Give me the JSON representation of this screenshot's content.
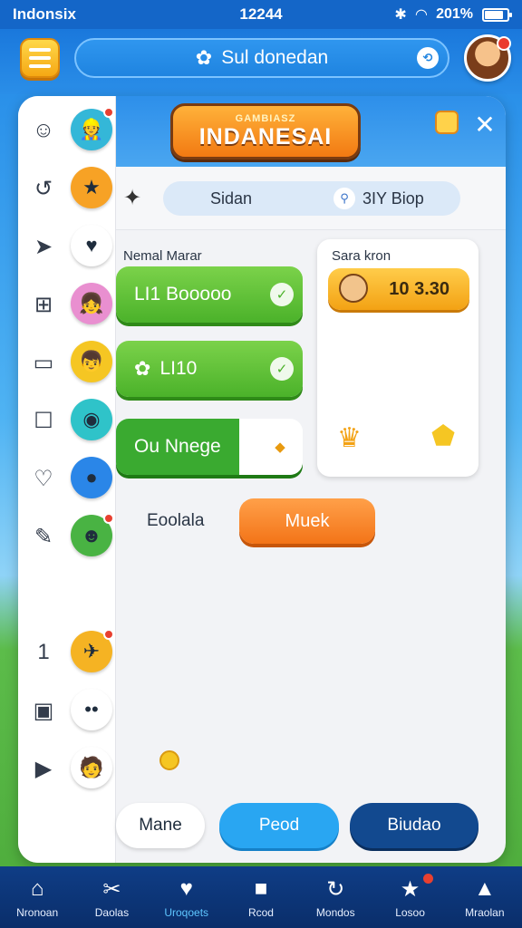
{
  "status_bar": {
    "app_name": "Indonsix",
    "time": "12244",
    "battery": "201%"
  },
  "topbar": {
    "search_text": "Sul donedan"
  },
  "rail": [
    {
      "glyph": "☺",
      "icon": "smiley-icon",
      "avatar": "👷",
      "avatar_bg": "#34b7d8",
      "dot": true
    },
    {
      "glyph": "↺",
      "icon": "refresh-icon",
      "avatar": "★",
      "avatar_bg": "#f7a225",
      "dot": false
    },
    {
      "glyph": "➤",
      "icon": "send-icon",
      "avatar": "♥",
      "avatar_bg": "#ffffff",
      "dot": false
    },
    {
      "glyph": "⊞",
      "icon": "grid-icon",
      "avatar": "👧",
      "avatar_bg": "#e98fd0",
      "dot": false
    },
    {
      "glyph": "▭",
      "icon": "clipboard-icon",
      "avatar": "👦",
      "avatar_bg": "#f5c623",
      "dot": false
    },
    {
      "glyph": "☐",
      "icon": "square-icon",
      "avatar": "◉",
      "avatar_bg": "#2fc3c9",
      "dot": false
    },
    {
      "glyph": "♡",
      "icon": "heart-icon",
      "avatar": "●",
      "avatar_bg": "#2a86e8",
      "dot": false
    },
    {
      "glyph": "✎",
      "icon": "edit-icon",
      "avatar": "☻",
      "avatar_bg": "#49b343",
      "dot": true
    },
    {
      "glyph": "",
      "icon": "blank-icon",
      "avatar": "",
      "avatar_bg": "#f2f3f6",
      "dot": false
    },
    {
      "glyph": "1",
      "icon": "number-icon",
      "avatar": "✈",
      "avatar_bg": "#f5b323",
      "dot": true
    },
    {
      "glyph": "▣",
      "icon": "image-icon",
      "avatar": "••",
      "avatar_bg": "#ffffff",
      "dot": false
    },
    {
      "glyph": "▶",
      "icon": "play-icon",
      "avatar": "🧑",
      "avatar_bg": "#ffffff",
      "dot": false
    }
  ],
  "banner": {
    "subtitle": "GAMBIASZ",
    "title": "INDANESAI"
  },
  "subbar": {
    "tab_left": "Sidan",
    "tab_right": "3IY Biop"
  },
  "left_section": {
    "title": "Nemal Marar",
    "buttons": [
      {
        "label": "LI1  Booooo",
        "style": "green"
      },
      {
        "label": "LI10",
        "style": "green"
      },
      {
        "label": "Ou Nnege",
        "style": "dgreen"
      }
    ]
  },
  "right_card": {
    "title": "Sara kron",
    "value": "10 3.30"
  },
  "action_row": {
    "label": "Eoolala",
    "button": "Muek"
  },
  "bottom_buttons": [
    {
      "label": "Mane",
      "bg": "#ffffff",
      "color": "#1f2d3d"
    },
    {
      "label": "Peod",
      "bg": "#29a6f2",
      "color": "#ffffff"
    },
    {
      "label": "Biudao",
      "bg": "#12498f",
      "color": "#ffffff"
    }
  ],
  "bottom_nav": [
    {
      "label": "Nronoan",
      "icon": "home-icon",
      "glyph": "⌂",
      "active": false,
      "badge": false
    },
    {
      "label": "Daolas",
      "icon": "tools-icon",
      "glyph": "✂",
      "active": false,
      "badge": false
    },
    {
      "label": "Uroqoets",
      "icon": "tooth-icon",
      "glyph": "♥",
      "active": true,
      "badge": false
    },
    {
      "label": "Rcod",
      "icon": "cube-icon",
      "glyph": "■",
      "active": false,
      "badge": false
    },
    {
      "label": "Mondos",
      "icon": "refresh-icon",
      "glyph": "↻",
      "active": false,
      "badge": false
    },
    {
      "label": "Losoo",
      "icon": "star-icon",
      "glyph": "★",
      "active": false,
      "badge": true
    },
    {
      "label": "Mraolan",
      "icon": "tower-icon",
      "glyph": "▲",
      "active": false,
      "badge": false
    }
  ]
}
